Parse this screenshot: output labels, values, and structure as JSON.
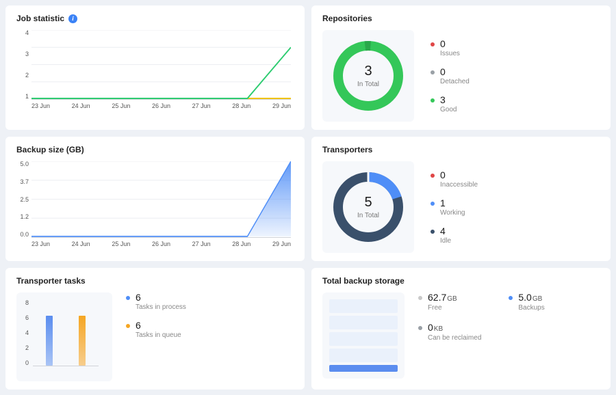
{
  "job_statistic": {
    "title": "Job statistic",
    "y_ticks": [
      "4",
      "3",
      "2",
      "1"
    ],
    "x_labels": [
      "23 Jun",
      "24 Jun",
      "25 Jun",
      "26 Jun",
      "27 Jun",
      "28 Jun",
      "29 Jun"
    ]
  },
  "backup_size": {
    "title": "Backup size (GB)",
    "y_ticks": [
      "5.0",
      "3.7",
      "2.5",
      "1.2",
      "0.0"
    ],
    "x_labels": [
      "23 Jun",
      "24 Jun",
      "25 Jun",
      "26 Jun",
      "27 Jun",
      "28 Jun",
      "29 Jun"
    ]
  },
  "repositories": {
    "title": "Repositories",
    "total_value": "3",
    "total_label": "In Total",
    "items": [
      {
        "value": "0",
        "label": "Issues",
        "color": "#e04646"
      },
      {
        "value": "0",
        "label": "Detached",
        "color": "#9aa0a6"
      },
      {
        "value": "3",
        "label": "Good",
        "color": "#34c759"
      }
    ]
  },
  "transporters": {
    "title": "Transporters",
    "total_value": "5",
    "total_label": "In Total",
    "items": [
      {
        "value": "0",
        "label": "Inaccessible",
        "color": "#e04646"
      },
      {
        "value": "1",
        "label": "Working",
        "color": "#4f8ef7"
      },
      {
        "value": "4",
        "label": "Idle",
        "color": "#3a506b"
      }
    ]
  },
  "transporter_tasks": {
    "title": "Transporter tasks",
    "y_ticks": [
      "8",
      "6",
      "4",
      "2",
      "0"
    ],
    "items": [
      {
        "value": "6",
        "label": "Tasks in process",
        "color": "#4f8ef7"
      },
      {
        "value": "6",
        "label": "Tasks in queue",
        "color": "#f5a623"
      }
    ]
  },
  "total_backup_storage": {
    "title": "Total backup storage",
    "items": [
      {
        "value": "62.7",
        "unit": "GB",
        "label": "Free",
        "color": "#c9c9c9"
      },
      {
        "value": "5.0",
        "unit": "GB",
        "label": "Backups",
        "color": "#4f8ef7"
      },
      {
        "value": "0",
        "unit": "KB",
        "label": "Can be reclaimed",
        "color": "#9aa0a6"
      }
    ]
  },
  "chart_data": [
    {
      "type": "line",
      "title": "Job statistic",
      "x": [
        "23 Jun",
        "24 Jun",
        "25 Jun",
        "26 Jun",
        "27 Jun",
        "28 Jun",
        "29 Jun"
      ],
      "series": [
        {
          "name": "green",
          "values": [
            0,
            0,
            0,
            0,
            0,
            0,
            3
          ],
          "color": "#2ecc71"
        },
        {
          "name": "yellow",
          "values": [
            0,
            0,
            0,
            0,
            0,
            0,
            0
          ],
          "color": "#f1c40f"
        }
      ],
      "ylim": [
        0,
        4
      ],
      "y_ticks": [
        1,
        2,
        3,
        4
      ],
      "grid": true
    },
    {
      "type": "area",
      "title": "Backup size (GB)",
      "x": [
        "23 Jun",
        "24 Jun",
        "25 Jun",
        "26 Jun",
        "27 Jun",
        "28 Jun",
        "29 Jun"
      ],
      "series": [
        {
          "name": "Backup size",
          "values": [
            0,
            0,
            0,
            0,
            0,
            0,
            5.0
          ],
          "color": "#4f8ef7"
        }
      ],
      "ylim": [
        0,
        5.0
      ],
      "y_ticks": [
        0.0,
        1.2,
        2.5,
        3.7,
        5.0
      ],
      "grid": true
    },
    {
      "type": "pie",
      "title": "Repositories",
      "total": 3,
      "slices": [
        {
          "name": "Issues",
          "value": 0,
          "color": "#e04646"
        },
        {
          "name": "Detached",
          "value": 0,
          "color": "#9aa0a6"
        },
        {
          "name": "Good",
          "value": 3,
          "color": "#34c759"
        }
      ]
    },
    {
      "type": "pie",
      "title": "Transporters",
      "total": 5,
      "slices": [
        {
          "name": "Inaccessible",
          "value": 0,
          "color": "#e04646"
        },
        {
          "name": "Working",
          "value": 1,
          "color": "#4f8ef7"
        },
        {
          "name": "Idle",
          "value": 4,
          "color": "#3a506b"
        }
      ]
    },
    {
      "type": "bar",
      "title": "Transporter tasks",
      "categories": [
        "Tasks in process",
        "Tasks in queue"
      ],
      "values": [
        6,
        6
      ],
      "colors": [
        "#4f8ef7",
        "#f5a623"
      ],
      "ylim": [
        0,
        8
      ],
      "y_ticks": [
        0,
        2,
        4,
        6,
        8
      ]
    },
    {
      "type": "bar",
      "title": "Total backup storage",
      "categories": [
        "Free",
        "Backups",
        "Can be reclaimed"
      ],
      "values": [
        62.7,
        5.0,
        0
      ],
      "units": [
        "GB",
        "GB",
        "KB"
      ],
      "colors": [
        "#c9c9c9",
        "#4f8ef7",
        "#9aa0a6"
      ]
    }
  ]
}
